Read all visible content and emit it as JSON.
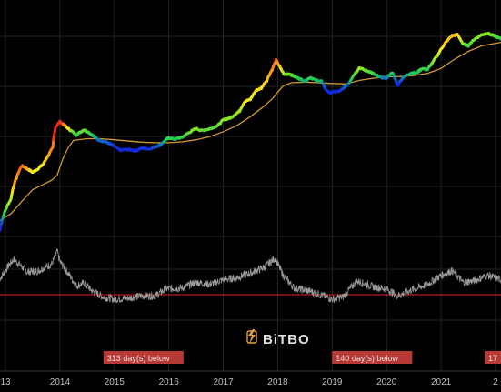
{
  "watermark": {
    "text": "BiTBO",
    "icon": "bitbo-logo-icon",
    "color": "#e8a33c"
  },
  "badges": [
    {
      "text": "313 day(s) below",
      "x": 2014.8
    },
    {
      "text": "140 day(s) below",
      "x": 2019.0
    },
    {
      "text": "17",
      "x": 2021.97
    }
  ],
  "colors": {
    "background": "#000000",
    "grid": "#232323",
    "ma_line": "#d39a2e",
    "oscillator": "#9a9a9a",
    "threshold": "#b31d1d",
    "badge": "#b83a36",
    "tick_text": "#bdbdbd"
  },
  "chart_data": {
    "type": "line",
    "title": "",
    "xlabel": "",
    "ylabel": "",
    "x_axis": {
      "ticks": [
        "13",
        "2014",
        "2015",
        "2016",
        "2017",
        "2018",
        "2019",
        "2020",
        "2021",
        "2"
      ],
      "tick_positions": [
        2013,
        2014,
        2015,
        2016,
        2017,
        2018,
        2019,
        2020,
        2021,
        2022
      ],
      "range": [
        2012.9,
        2022.1
      ]
    },
    "y_scale": "log",
    "grid": true,
    "legend": "none",
    "series": [
      {
        "role": "price",
        "coloring": "gradient by ratio to moving average (red-orange-yellow-green-blue)",
        "points": [
          [
            2012.9,
            5
          ],
          [
            2013.0,
            13
          ],
          [
            2013.1,
            22
          ],
          [
            2013.2,
            60
          ],
          [
            2013.3,
            110
          ],
          [
            2013.4,
            95
          ],
          [
            2013.5,
            80
          ],
          [
            2013.6,
            95
          ],
          [
            2013.7,
            120
          ],
          [
            2013.8,
            190
          ],
          [
            2013.87,
            260
          ],
          [
            2013.92,
            700
          ],
          [
            2014.0,
            900
          ],
          [
            2014.05,
            820
          ],
          [
            2014.15,
            650
          ],
          [
            2014.3,
            480
          ],
          [
            2014.45,
            620
          ],
          [
            2014.55,
            520
          ],
          [
            2014.7,
            380
          ],
          [
            2014.85,
            340
          ],
          [
            2015.0,
            280
          ],
          [
            2015.1,
            230
          ],
          [
            2015.25,
            240
          ],
          [
            2015.4,
            225
          ],
          [
            2015.5,
            255
          ],
          [
            2015.65,
            245
          ],
          [
            2015.85,
            300
          ],
          [
            2016.0,
            420
          ],
          [
            2016.1,
            390
          ],
          [
            2016.25,
            430
          ],
          [
            2016.4,
            560
          ],
          [
            2016.5,
            650
          ],
          [
            2016.6,
            590
          ],
          [
            2016.75,
            640
          ],
          [
            2016.9,
            750
          ],
          [
            2017.0,
            980
          ],
          [
            2017.15,
            1100
          ],
          [
            2017.3,
            1500
          ],
          [
            2017.4,
            2400
          ],
          [
            2017.5,
            2600
          ],
          [
            2017.6,
            4000
          ],
          [
            2017.7,
            4500
          ],
          [
            2017.8,
            6500
          ],
          [
            2017.9,
            11000
          ],
          [
            2017.97,
            17000
          ],
          [
            2018.05,
            11500
          ],
          [
            2018.12,
            8500
          ],
          [
            2018.2,
            9000
          ],
          [
            2018.35,
            7400
          ],
          [
            2018.5,
            6300
          ],
          [
            2018.6,
            7500
          ],
          [
            2018.7,
            6500
          ],
          [
            2018.8,
            6300
          ],
          [
            2018.88,
            4200
          ],
          [
            2018.95,
            3600
          ],
          [
            2019.0,
            3700
          ],
          [
            2019.15,
            3900
          ],
          [
            2019.3,
            5500
          ],
          [
            2019.45,
            10000
          ],
          [
            2019.5,
            12000
          ],
          [
            2019.6,
            10500
          ],
          [
            2019.7,
            9800
          ],
          [
            2019.8,
            8300
          ],
          [
            2019.9,
            7500
          ],
          [
            2020.0,
            7200
          ],
          [
            2020.1,
            9500
          ],
          [
            2020.2,
            5000
          ],
          [
            2020.3,
            7500
          ],
          [
            2020.45,
            9300
          ],
          [
            2020.55,
            9200
          ],
          [
            2020.65,
            11500
          ],
          [
            2020.75,
            10800
          ],
          [
            2020.85,
            15500
          ],
          [
            2020.95,
            23000
          ],
          [
            2021.05,
            35000
          ],
          [
            2021.2,
            55000
          ],
          [
            2021.3,
            58000
          ],
          [
            2021.4,
            37000
          ],
          [
            2021.5,
            34000
          ],
          [
            2021.6,
            45000
          ],
          [
            2021.75,
            58000
          ],
          [
            2021.85,
            62000
          ],
          [
            2022.1,
            47000
          ]
        ]
      },
      {
        "role": "moving average",
        "color": "#d39a2e",
        "points": [
          [
            2012.9,
            8
          ],
          [
            2013.1,
            11
          ],
          [
            2013.3,
            20
          ],
          [
            2013.5,
            35
          ],
          [
            2013.7,
            45
          ],
          [
            2013.85,
            55
          ],
          [
            2013.95,
            70
          ],
          [
            2014.05,
            150
          ],
          [
            2014.15,
            260
          ],
          [
            2014.25,
            370
          ],
          [
            2014.5,
            400
          ],
          [
            2014.75,
            400
          ],
          [
            2015.0,
            380
          ],
          [
            2015.5,
            340
          ],
          [
            2015.75,
            330
          ],
          [
            2016.0,
            330
          ],
          [
            2016.25,
            345
          ],
          [
            2016.5,
            380
          ],
          [
            2016.75,
            440
          ],
          [
            2017.0,
            560
          ],
          [
            2017.25,
            750
          ],
          [
            2017.5,
            1150
          ],
          [
            2017.75,
            1900
          ],
          [
            2017.9,
            2700
          ],
          [
            2018.0,
            3700
          ],
          [
            2018.1,
            5000
          ],
          [
            2018.25,
            5800
          ],
          [
            2018.5,
            6000
          ],
          [
            2018.75,
            5800
          ],
          [
            2019.0,
            5600
          ],
          [
            2019.25,
            5500
          ],
          [
            2019.5,
            6500
          ],
          [
            2019.75,
            7200
          ],
          [
            2020.0,
            7700
          ],
          [
            2020.25,
            7800
          ],
          [
            2020.5,
            8200
          ],
          [
            2020.75,
            9100
          ],
          [
            2021.0,
            11500
          ],
          [
            2021.25,
            18000
          ],
          [
            2021.5,
            26000
          ],
          [
            2021.75,
            34000
          ],
          [
            2022.1,
            40000
          ]
        ]
      },
      {
        "role": "oscillator",
        "color": "#9a9a9a",
        "points": [
          [
            2012.9,
            0.7
          ],
          [
            2013.05,
            1.25
          ],
          [
            2013.15,
            1.55
          ],
          [
            2013.25,
            1.35
          ],
          [
            2013.4,
            1.0
          ],
          [
            2013.6,
            1.05
          ],
          [
            2013.85,
            1.35
          ],
          [
            2013.95,
            1.9
          ],
          [
            2014.0,
            1.45
          ],
          [
            2014.15,
            0.95
          ],
          [
            2014.3,
            0.4
          ],
          [
            2014.45,
            0.5
          ],
          [
            2014.6,
            0.15
          ],
          [
            2014.8,
            -0.1
          ],
          [
            2015.0,
            -0.2
          ],
          [
            2015.25,
            -0.15
          ],
          [
            2015.5,
            -0.05
          ],
          [
            2015.75,
            -0.05
          ],
          [
            2015.95,
            0.25
          ],
          [
            2016.25,
            0.3
          ],
          [
            2016.5,
            0.55
          ],
          [
            2016.75,
            0.45
          ],
          [
            2017.0,
            0.65
          ],
          [
            2017.25,
            0.75
          ],
          [
            2017.5,
            0.95
          ],
          [
            2017.75,
            1.2
          ],
          [
            2017.95,
            1.6
          ],
          [
            2018.1,
            0.85
          ],
          [
            2018.3,
            0.3
          ],
          [
            2018.6,
            0.15
          ],
          [
            2018.9,
            -0.1
          ],
          [
            2019.0,
            -0.2
          ],
          [
            2019.2,
            -0.1
          ],
          [
            2019.45,
            0.6
          ],
          [
            2019.75,
            0.35
          ],
          [
            2020.0,
            0.25
          ],
          [
            2020.2,
            -0.05
          ],
          [
            2020.45,
            0.2
          ],
          [
            2020.75,
            0.45
          ],
          [
            2021.0,
            0.85
          ],
          [
            2021.2,
            1.05
          ],
          [
            2021.4,
            0.55
          ],
          [
            2021.6,
            0.6
          ],
          [
            2021.85,
            0.85
          ],
          [
            2022.1,
            0.65
          ]
        ]
      }
    ],
    "threshold": 0
  }
}
